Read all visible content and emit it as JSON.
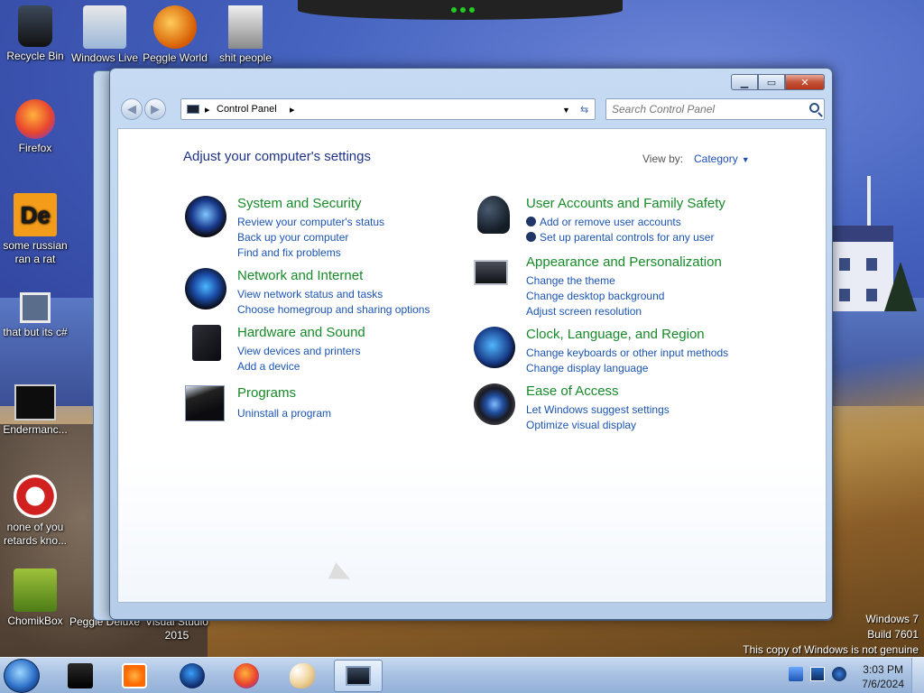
{
  "desktop": {
    "icons": [
      {
        "label": "Recycle Bin",
        "icon": "recycle-bin-icon"
      },
      {
        "label": "Windows Live",
        "icon": "windows-live-icon"
      },
      {
        "label": "Peggle World",
        "icon": "peggle-icon"
      },
      {
        "label": "shit people",
        "icon": "folder-icon"
      },
      {
        "label": "Firefox",
        "icon": "firefox-icon"
      },
      {
        "label": "some russian ran a rat",
        "icon": "de-icon"
      },
      {
        "label": "that but its c#",
        "icon": "stack-icon"
      },
      {
        "label": "Endermanc...",
        "icon": "console-icon"
      },
      {
        "label": "none of you retards kno...",
        "icon": "red-app-icon"
      },
      {
        "label": "ChomikBox",
        "icon": "chomikbox-icon"
      }
    ],
    "partial_labels": {
      "peggle_deluxe": "Peggle Deluxe",
      "visual_studio": "Visual Studio 2015"
    }
  },
  "window": {
    "address": {
      "crumb": "Control Panel"
    },
    "search": {
      "placeholder": "Search Control Panel"
    },
    "page_title": "Adjust your computer's settings",
    "view_by_label": "View by:",
    "view_by_value": "Category",
    "categories": [
      {
        "title": "System and Security",
        "icon": "system-security-icon",
        "links": [
          "Review your computer's status",
          "Back up your computer",
          "Find and fix problems"
        ]
      },
      {
        "title": "Network and Internet",
        "icon": "network-icon",
        "links": [
          "View network status and tasks",
          "Choose homegroup and sharing options"
        ]
      },
      {
        "title": "Hardware and Sound",
        "icon": "hardware-icon",
        "links": [
          "View devices and printers",
          "Add a device"
        ]
      },
      {
        "title": "Programs",
        "icon": "programs-icon",
        "links": [
          "Uninstall a program"
        ]
      },
      {
        "title": "User Accounts and Family Safety",
        "icon": "user-accounts-icon",
        "links": [
          "Add or remove user accounts",
          "Set up parental controls for any user"
        ]
      },
      {
        "title": "Appearance and Personalization",
        "icon": "appearance-icon",
        "links": [
          "Change the theme",
          "Change desktop background",
          "Adjust screen resolution"
        ]
      },
      {
        "title": "Clock, Language, and Region",
        "icon": "clock-icon",
        "links": [
          "Change keyboards or other input methods",
          "Change display language"
        ]
      },
      {
        "title": "Ease of Access",
        "icon": "ease-of-access-icon",
        "links": [
          "Let Windows suggest settings",
          "Optimize visual display"
        ]
      }
    ]
  },
  "watermark": {
    "line1": "Windows 7",
    "line2": "Build 7601",
    "line3": "This copy of Windows is not genuine"
  },
  "taskbar": {
    "clock_time": "3:03 PM",
    "clock_date": "7/6/2024"
  },
  "colors": {
    "link": "#1c54b3",
    "category_title": "#178a29",
    "page_title": "#1e3287"
  }
}
